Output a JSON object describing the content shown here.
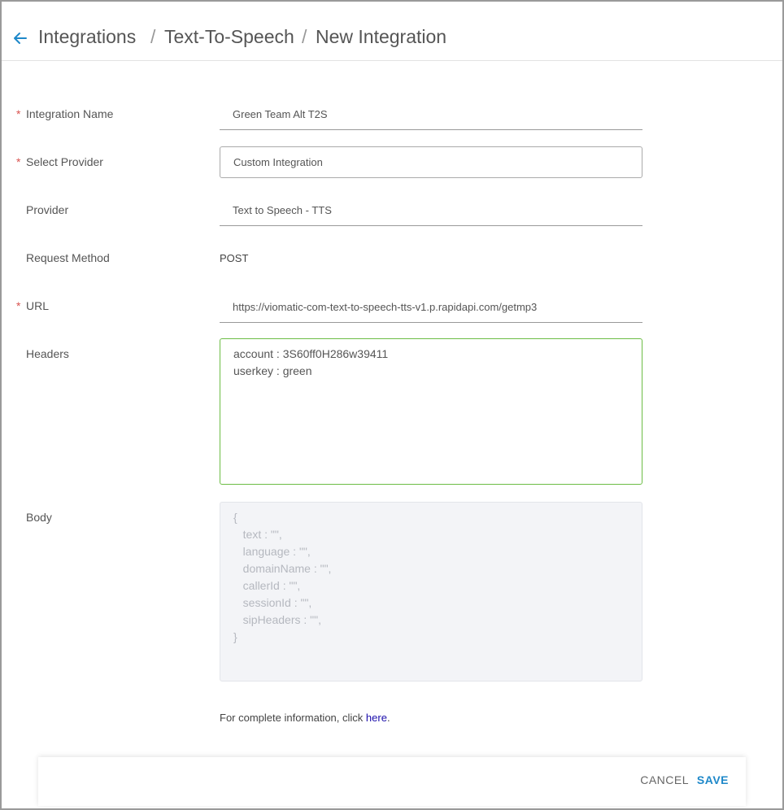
{
  "breadcrumb": {
    "items": [
      "Integrations",
      "Text-To-Speech",
      "New Integration"
    ],
    "separator": "/"
  },
  "form": {
    "integration_name": {
      "label": "Integration Name",
      "required": "*",
      "value": "Green Team Alt T2S"
    },
    "select_provider": {
      "label": "Select Provider",
      "required": "*",
      "value": "Custom Integration"
    },
    "provider": {
      "label": "Provider",
      "value": "Text to Speech - TTS"
    },
    "request_method": {
      "label": "Request Method",
      "value": "POST"
    },
    "url": {
      "label": "URL",
      "required": "*",
      "value": "https://viomatic-com-text-to-speech-tts-v1.p.rapidapi.com/getmp3"
    },
    "headers": {
      "label": "Headers",
      "value": "account : 3S60ff0H286w39411\nuserkey : green"
    },
    "body": {
      "label": "Body",
      "lines": [
        "{",
        "   text : \"\",",
        "   language : \"\",",
        "   domainName : \"\",",
        "   callerId : \"\",",
        "   sessionId : \"\",",
        "   sipHeaders : \"\",",
        "}"
      ]
    }
  },
  "info": {
    "text": "For complete information, click ",
    "link": "here",
    "suffix": "."
  },
  "footer": {
    "cancel_label": "CANCEL",
    "save_label": "SAVE"
  },
  "colors": {
    "accent": "#1e88c9",
    "required": "#d9534f",
    "active_border": "#6cbd45"
  },
  "icons": {
    "back": "arrow-left-icon"
  }
}
